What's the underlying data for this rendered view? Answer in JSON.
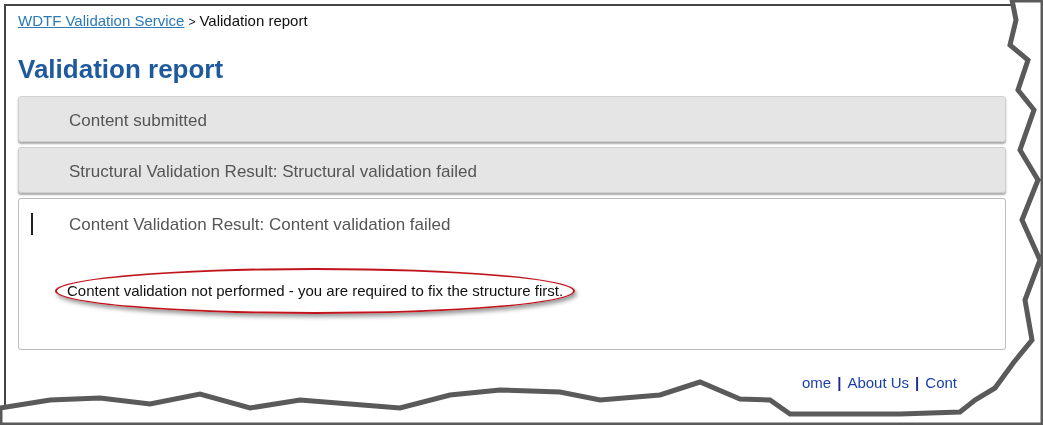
{
  "breadcrumb": [
    {
      "kind": "link",
      "text": "WDTF Validation Service"
    },
    {
      "kind": "separator",
      "text": ">"
    },
    {
      "kind": "current",
      "text": "Validation report"
    }
  ],
  "title": "Validation report",
  "sections": [
    {
      "header": "Content submitted",
      "expanded": false
    },
    {
      "header": "Structural Validation Result: Structural validation failed",
      "expanded": false
    },
    {
      "header": "Content Validation Result: Content validation failed",
      "expanded": true,
      "body": "Content validation not performed - you are required to fix the structure first.",
      "highlighted": true
    }
  ],
  "footer": [
    {
      "kind": "link",
      "text": "ome"
    },
    {
      "kind": "separator",
      "text": "|"
    },
    {
      "kind": "link",
      "text": "About Us"
    },
    {
      "kind": "separator",
      "text": "|"
    },
    {
      "kind": "link",
      "text": "Cont"
    }
  ]
}
